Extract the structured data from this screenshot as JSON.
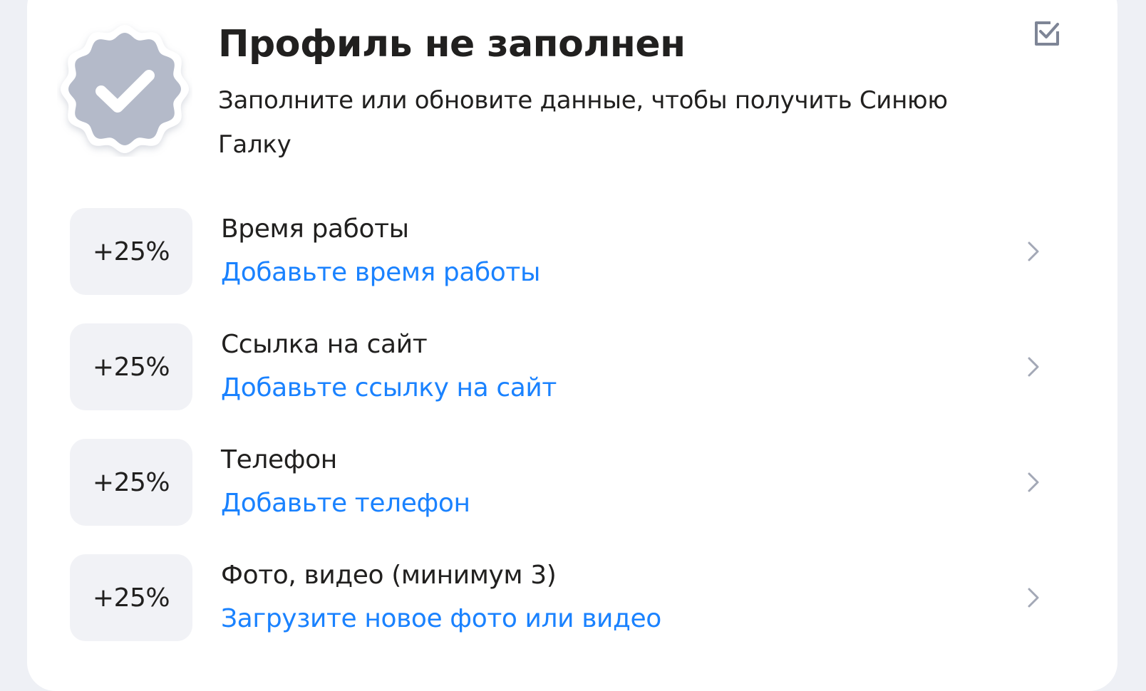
{
  "profile_status": {
    "title": "Профиль не заполнен",
    "subtitle": "Заполните или обновите данные, чтобы получить Синюю Галку",
    "badge_icon": "verified-checkmark-icon",
    "badge_color": "#b4bac9",
    "edit_icon": "checkbox-edit-icon"
  },
  "tasks": [
    {
      "percent": "+25%",
      "title": "Время работы",
      "action": "Добавьте время работы"
    },
    {
      "percent": "+25%",
      "title": "Ссылка на сайт",
      "action": "Добавьте ссылку на сайт"
    },
    {
      "percent": "+25%",
      "title": "Телефон",
      "action": "Добавьте телефон"
    },
    {
      "percent": "+25%",
      "title": "Фото, видео (минимум 3)",
      "action": "Загрузите новое фото или видео"
    }
  ],
  "colors": {
    "page_background": "#eef0f5",
    "card_background": "#ffffff",
    "text_primary": "#21201f",
    "link": "#1a82ff",
    "percent_chip": "#f1f2f6"
  }
}
